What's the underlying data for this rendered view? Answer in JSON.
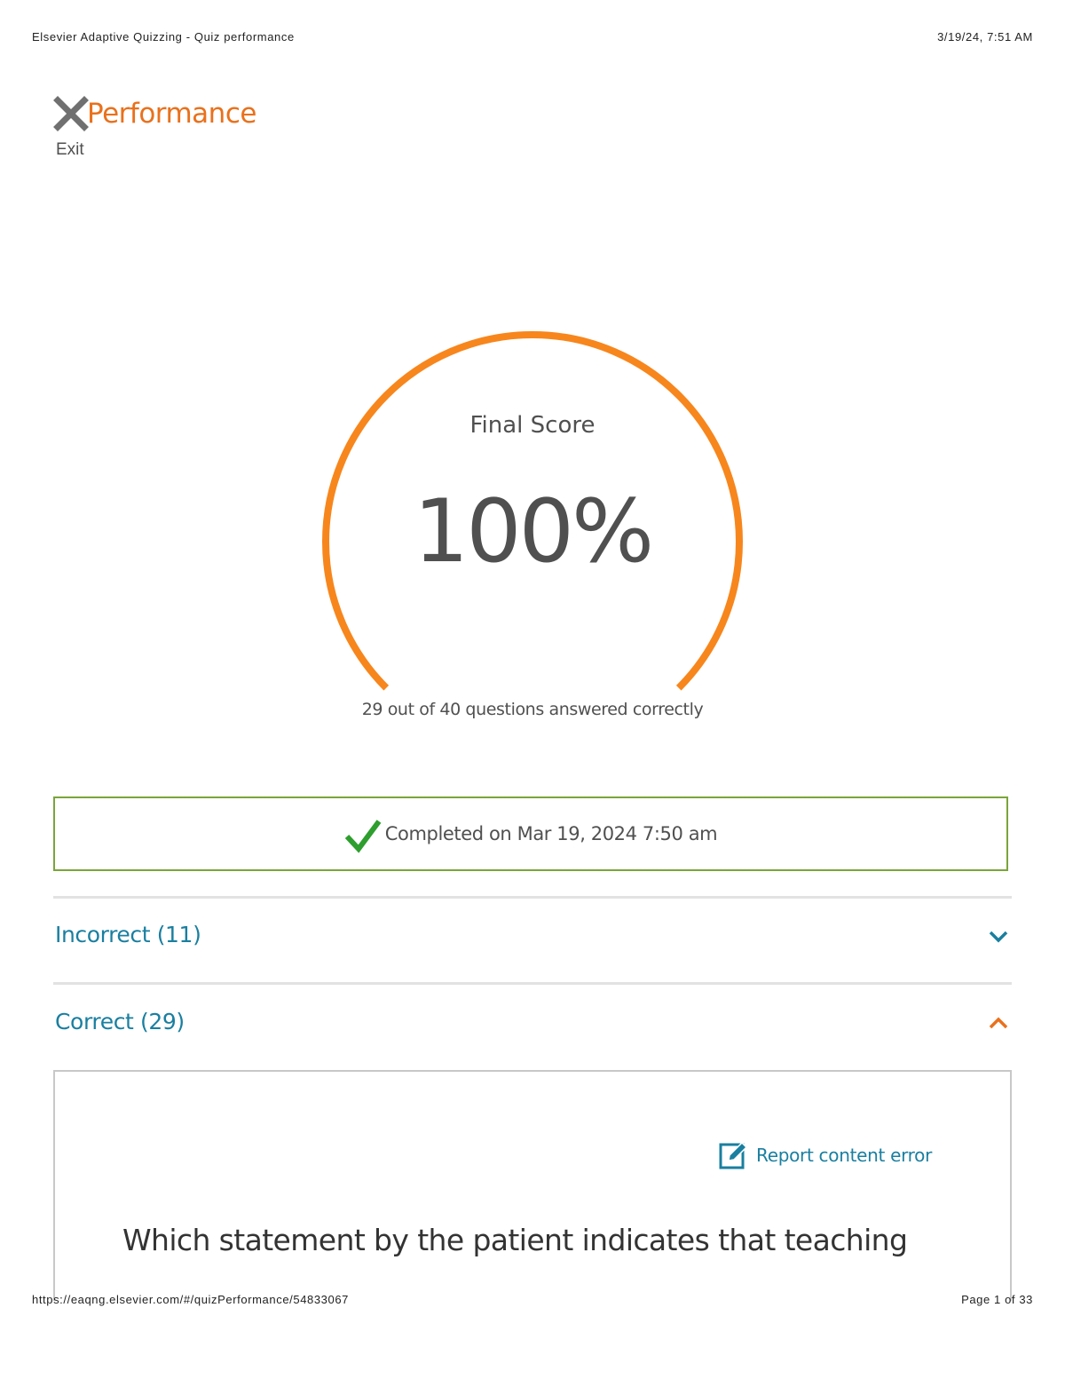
{
  "print_header": {
    "page_title": "Elsevier Adaptive Quizzing - Quiz performance",
    "printed_at": "3/19/24, 7:51 AM"
  },
  "print_footer": {
    "url": "https://eaqng.elsevier.com/#/quizPerformance/54833067",
    "page_number": "Page 1 of 33"
  },
  "topbar": {
    "exit_icon": "close-x-icon",
    "exit_label": "Exit",
    "title": "Performance"
  },
  "score": {
    "label": "Final Score",
    "value": "100%",
    "fill_fraction": 1.0,
    "summary": "29 out of 40 questions answered correctly"
  },
  "completion": {
    "icon": "checkmark-icon",
    "text": "Completed on Mar 19, 2024 7:50 am"
  },
  "sections": [
    {
      "label": "Incorrect (11)",
      "expanded": false,
      "icon": "chevron-down-icon"
    },
    {
      "label": "Correct (29)",
      "expanded": true,
      "icon": "chevron-up-icon"
    }
  ],
  "question": {
    "report_icon": "edit-icon",
    "report_label": "Report content error",
    "text": "Which statement by the patient indicates that teaching"
  },
  "colors": {
    "accent_orange": "#f7861d",
    "title_orange": "#e9711c",
    "link_blue": "#1a7fa0",
    "success_green": "#7aa53a",
    "check_green": "#2e9e2e",
    "text_gray": "#505050"
  }
}
